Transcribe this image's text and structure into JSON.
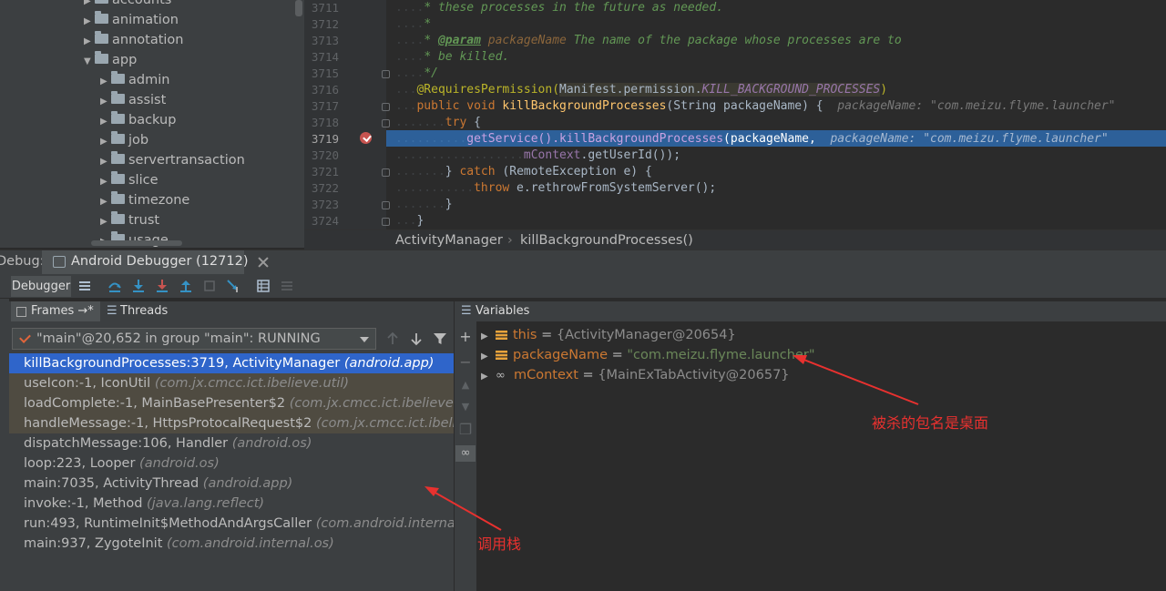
{
  "colors": {
    "accent": "#2f65ca",
    "annotation": "#e8312f",
    "breakpoint": "#c75450",
    "execution_line": "#2d6099"
  },
  "project_tree": {
    "items": [
      {
        "label": "accounts",
        "expanded": false
      },
      {
        "label": "animation",
        "expanded": false
      },
      {
        "label": "annotation",
        "expanded": false
      },
      {
        "label": "app",
        "expanded": true
      },
      {
        "label": "admin",
        "expanded": false
      },
      {
        "label": "assist",
        "expanded": false
      },
      {
        "label": "backup",
        "expanded": false
      },
      {
        "label": "job",
        "expanded": false
      },
      {
        "label": "servertransaction",
        "expanded": false
      },
      {
        "label": "slice",
        "expanded": false
      },
      {
        "label": "timezone",
        "expanded": false
      },
      {
        "label": "trust",
        "expanded": false
      },
      {
        "label": "usage",
        "expanded": false
      }
    ]
  },
  "editor": {
    "line_numbers": [
      "3711",
      "3712",
      "3713",
      "3714",
      "3715",
      "3716",
      "3717",
      "3718",
      "3719",
      "3720",
      "3721",
      "3722",
      "3723",
      "3724"
    ],
    "current_line": "3719",
    "code": {
      "l3711": "* these processes in the future as needed.",
      "l3712": "*",
      "l3713_tag": "@param",
      "l3713_param": "packageName",
      "l3713_text": "The name of the package whose processes are to",
      "l3714": "* be killed.",
      "l3715": "*/",
      "l3716_ann": "@RequiresPermission(",
      "l3716_arg": "Manifest.permission.",
      "l3716_const": "KILL_BACKGROUND_PROCESSES",
      "l3716_close": ")",
      "l3717_kw": "public void ",
      "l3717_fn": "killBackgroundProcesses",
      "l3717_params": "(String packageName) {",
      "l3717_hint": "packageName: \"com.meizu.flyme.launcher\"",
      "l3718_kw": "try",
      "l3718_rest": " {",
      "l3719_call": "getService().",
      "l3719_method": "killBackgroundProcesses",
      "l3719_args": "(packageName,",
      "l3719_hint": "packageName: \"com.meizu.flyme.launcher\"",
      "l3720_field": "mContext",
      "l3720_rest": ".getUserId());",
      "l3721_open": "} ",
      "l3721_kw": "catch",
      "l3721_rest": " (RemoteException e) {",
      "l3722_kw": "throw",
      "l3722_rest": " e.rethrowFromSystemServer();",
      "l3723": "}",
      "l3724": "}"
    },
    "breadcrumb": [
      "ActivityManager",
      "killBackgroundProcesses()"
    ]
  },
  "debug": {
    "label": "Debug:",
    "session_tab": "Android Debugger (12712)",
    "toolbar_tab": "Debugger",
    "frames_tab": "Frames →*",
    "threads_tab": "Threads →*",
    "thread_selector": "\"main\"@20,652 in group \"main\": RUNNING",
    "frames": [
      {
        "method": "killBackgroundProcesses:3719, ActivityManager",
        "package": "(android.app)",
        "state": "selected"
      },
      {
        "method": "useIcon:-1, IconUtil",
        "package": "(com.jx.cmcc.ict.ibelieve.util)",
        "state": "lib"
      },
      {
        "method": "loadComplete:-1, MainBasePresenter$2",
        "package": "(com.jx.cmcc.ict.ibelieve.mvp.p",
        "state": "lib"
      },
      {
        "method": "handleMessage:-1, HttpsProtocalRequest$2",
        "package": "(com.jx.cmcc.ict.ibelieve.r",
        "state": "lib"
      },
      {
        "method": "dispatchMessage:106, Handler",
        "package": "(android.os)",
        "state": "normal"
      },
      {
        "method": "loop:223, Looper",
        "package": "(android.os)",
        "state": "normal"
      },
      {
        "method": "main:7035, ActivityThread",
        "package": "(android.app)",
        "state": "normal"
      },
      {
        "method": "invoke:-1, Method",
        "package": "(java.lang.reflect)",
        "state": "normal"
      },
      {
        "method": "run:493, RuntimeInit$MethodAndArgsCaller",
        "package": "(com.android.internal.os)",
        "state": "normal"
      },
      {
        "method": "main:937, ZygoteInit",
        "package": "(com.android.internal.os)",
        "state": "normal"
      }
    ],
    "variables_title": "Variables",
    "variables": [
      {
        "name": "this",
        "eq": " = ",
        "value": "{ActivityManager@20654}",
        "kind": "object",
        "icon": "field-icon"
      },
      {
        "name": "packageName",
        "eq": " = ",
        "value": "\"com.meizu.flyme.launcher\"",
        "kind": "string",
        "icon": "field-icon"
      },
      {
        "name": "mContext",
        "eq": " = ",
        "value": "{MainExTabActivity@20657}",
        "kind": "object",
        "icon": "watch-icon"
      }
    ]
  },
  "annotations": {
    "package_note": "被杀的包名是桌面",
    "stack_note": "调用栈"
  }
}
